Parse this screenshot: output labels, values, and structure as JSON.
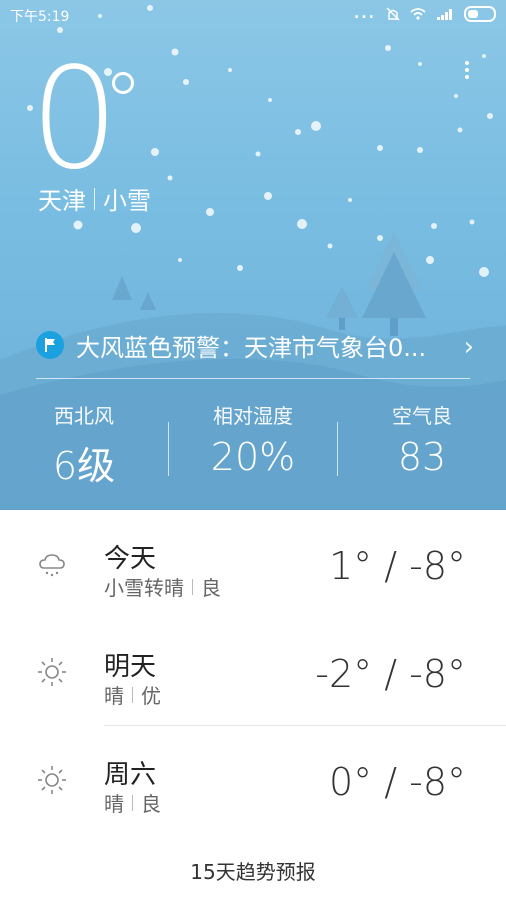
{
  "status_bar": {
    "time": "下午5:19",
    "more": "...",
    "icons": [
      "more-icon",
      "mute-icon",
      "wifi-icon",
      "signal-icon",
      "battery-icon"
    ]
  },
  "weather": {
    "temperature": "0",
    "city": "天津",
    "condition": "小雪"
  },
  "alert": {
    "icon": "warning-flag-icon",
    "text": "大风蓝色预警：天津市气象台0..."
  },
  "metrics": [
    {
      "label": "西北风",
      "value": "6级"
    },
    {
      "label": "相对湿度",
      "value": "20%"
    },
    {
      "label": "空气良",
      "value": "83"
    }
  ],
  "forecast": [
    {
      "day": "今天",
      "desc": "小雪转晴",
      "air": "良",
      "range": "1° / -8°",
      "icon": "cloud-snow-icon"
    },
    {
      "day": "明天",
      "desc": "晴",
      "air": "优",
      "range": "-2° / -8°",
      "icon": "sun-icon"
    },
    {
      "day": "周六",
      "desc": "晴",
      "air": "良",
      "range": "0° / -8°",
      "icon": "sun-icon"
    }
  ],
  "footer": {
    "trend_link": "15天趋势预报"
  },
  "colors": {
    "sky_top": "#8cc7e6",
    "sky_bottom": "#6aaed9",
    "alert_badge": "#1ba0e0"
  }
}
